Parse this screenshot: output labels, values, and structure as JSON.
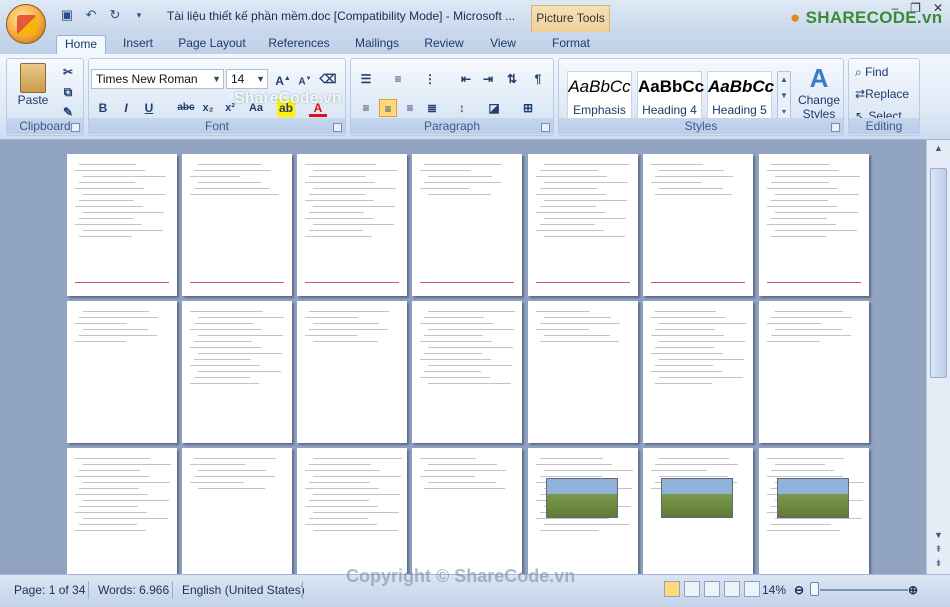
{
  "window": {
    "title": "Tài liệu thiết kế phần mềm.doc [Compatibility Mode] - Microsoft ...",
    "contextual_tab": "Picture Tools",
    "brand": "SHARECODE.vn",
    "controls": [
      "–",
      "❐",
      "✕"
    ]
  },
  "tabs": [
    "Home",
    "Insert",
    "Page Layout",
    "References",
    "Mailings",
    "Review",
    "View",
    "Format"
  ],
  "clipboard": {
    "paste_label": "Paste",
    "group_label": "Clipboard"
  },
  "font": {
    "family": "Times New Roman",
    "size": "14",
    "group_label": "Font"
  },
  "paragraph": {
    "group_label": "Paragraph"
  },
  "styles": {
    "group_label": "Styles",
    "tiles": [
      {
        "preview": "AaBbCc",
        "name": "Emphasis"
      },
      {
        "preview": "AaBbCc",
        "name": "Heading 4"
      },
      {
        "preview": "AaBbCc",
        "name": "Heading 5"
      }
    ],
    "change_label_1": "Change",
    "change_label_2": "Styles"
  },
  "editing": {
    "group_label": "Editing",
    "find": "Find",
    "replace": "Replace",
    "select": "Select"
  },
  "watermark": "ShareCode.vn",
  "copyright": "Copyright © ShareCode.vn",
  "status": {
    "page": "Page: 1 of 34",
    "words": "Words: 6.966",
    "language": "English (United States)",
    "zoom": "14%"
  }
}
